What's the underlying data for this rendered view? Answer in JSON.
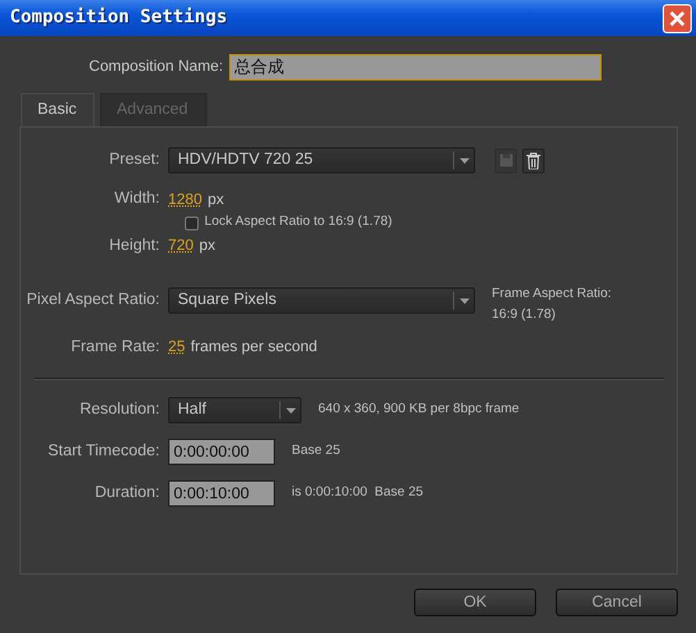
{
  "window": {
    "title": "Composition Settings"
  },
  "composition_name": {
    "label": "Composition Name:",
    "value": "总合成"
  },
  "tabs": [
    {
      "label": "Basic",
      "selected": true
    },
    {
      "label": "Advanced",
      "selected": false
    }
  ],
  "preset": {
    "label": "Preset:",
    "value": "HDV/HDTV 720 25",
    "actions": [
      {
        "kind": "save",
        "disabled": true
      },
      {
        "kind": "delete",
        "disabled": false
      }
    ]
  },
  "width": {
    "label": "Width:",
    "value": "1280",
    "unit": "px"
  },
  "height": {
    "label": "Height:",
    "value": "720",
    "unit": "px"
  },
  "lock_aspect": {
    "label": "Lock Aspect Ratio to 16:9 (1.78)",
    "checked": false
  },
  "pixel_aspect": {
    "label": "Pixel Aspect Ratio:",
    "value": "Square Pixels"
  },
  "frame_aspect": {
    "label": "Frame Aspect Ratio:",
    "value": "16:9 (1.78)"
  },
  "frame_rate": {
    "label": "Frame Rate:",
    "value": "25",
    "unit": "frames per second"
  },
  "resolution": {
    "label": "Resolution:",
    "value": "Half",
    "info": "640 x 360, 900 KB per 8bpc frame"
  },
  "start_timecode": {
    "label": "Start Timecode:",
    "value": "0:00:00:00",
    "note": "Base 25"
  },
  "duration": {
    "label": "Duration:",
    "value": "0:00:10:00",
    "note": "is 0:00:10:00  Base 25"
  },
  "buttons": [
    {
      "label": "OK"
    },
    {
      "label": "Cancel"
    }
  ]
}
